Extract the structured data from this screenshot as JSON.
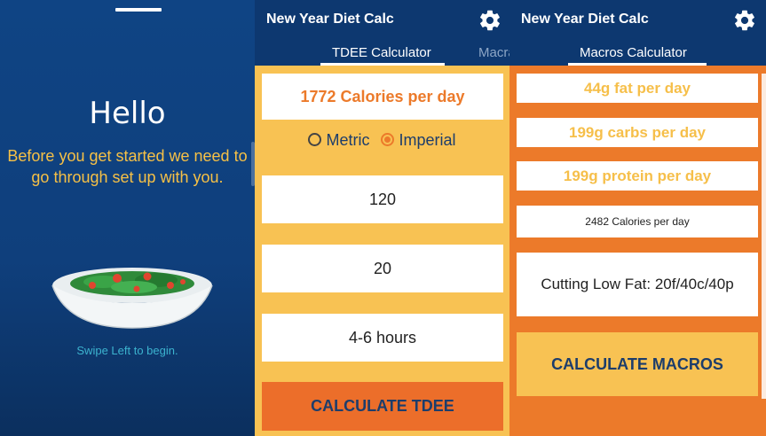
{
  "onboarding": {
    "title": "Hello",
    "intro": "Before you get started we need to go through set up with you.",
    "swipe_hint": "Swipe Left to begin."
  },
  "tdee_screen": {
    "app_title": "New Year Diet Calc",
    "tabs": [
      {
        "label": "TDEE Calculator",
        "active": true
      },
      {
        "label": "Macrator",
        "active": false
      }
    ],
    "result": "1772 Calories per day",
    "units": {
      "options": [
        "Metric",
        "Imperial"
      ],
      "selected": "Imperial"
    },
    "inputs": [
      {
        "value": "120"
      },
      {
        "value": "20"
      },
      {
        "value": "4-6 hours"
      }
    ],
    "button_label": "CALCULATE TDEE"
  },
  "macros_screen": {
    "app_title": "New Year Diet Calc",
    "tabs": [
      {
        "label": "Macros Calculator",
        "active": true
      }
    ],
    "results": {
      "fat": "44g fat per day",
      "carbs": "199g carbs per day",
      "protein": "199g protein per day",
      "calories": "2482 Calories per day"
    },
    "diet_plan": "Cutting Low Fat: 20f/40c/40p",
    "button_label": "CALCULATE MACROS"
  },
  "colors": {
    "navy": "#0d3870",
    "orange": "#ec7a2a",
    "yellow": "#f8c253",
    "teal": "#3cb3cf"
  },
  "icons": {
    "settings": "gear-icon",
    "food": "salad-bowl-icon"
  }
}
